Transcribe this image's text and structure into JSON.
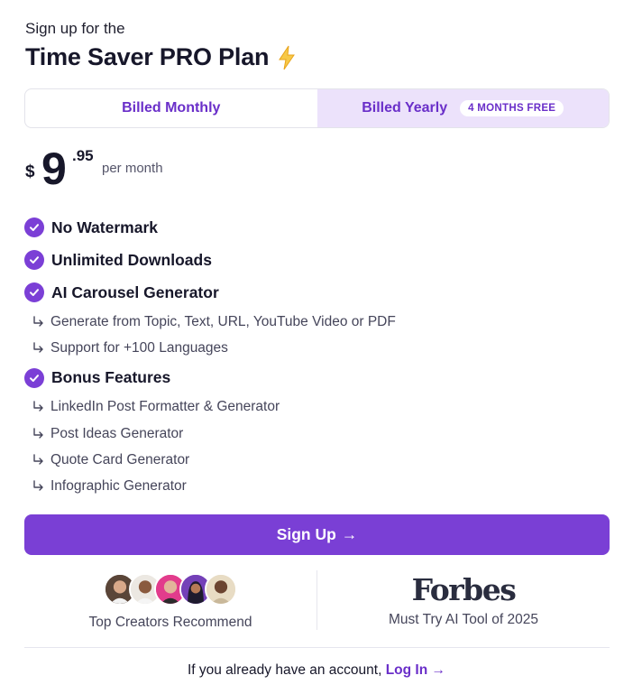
{
  "header": {
    "kicker": "Sign up for the",
    "title": "Time Saver PRO Plan"
  },
  "billing_toggle": {
    "monthly_label": "Billed Monthly",
    "yearly_label": "Billed Yearly",
    "yearly_badge": "4 MONTHS FREE",
    "selected": "yearly"
  },
  "price": {
    "currency": "$",
    "whole": "9",
    "cents": ".95",
    "period": "per month"
  },
  "features": [
    {
      "label": "No Watermark",
      "subs": []
    },
    {
      "label": "Unlimited Downloads",
      "subs": []
    },
    {
      "label": "AI Carousel Generator",
      "subs": [
        "Generate from Topic, Text, URL, YouTube Video or PDF",
        "Support for +100 Languages"
      ]
    },
    {
      "label": "Bonus Features",
      "subs": [
        "LinkedIn Post Formatter & Generator",
        "Post Ideas Generator",
        "Quote Card Generator",
        "Infographic Generator"
      ]
    }
  ],
  "cta": {
    "label": "Sign Up",
    "arrow": "→"
  },
  "social_proof": {
    "creators_caption": "Top Creators Recommend",
    "forbes_logo": "Forbes",
    "forbes_caption": "Must Try AI Tool of 2025"
  },
  "login": {
    "prompt": "If you already have an account,",
    "link": "Log In",
    "arrow": "→"
  },
  "colors": {
    "accent": "#7a3fd5",
    "accent_light": "#ece2fb",
    "text": "#17172a",
    "muted": "#45455a"
  },
  "icons": {
    "bolt": "lightning-bolt-icon",
    "check": "check-circle-icon",
    "sub_arrow": "corner-down-right-icon"
  }
}
